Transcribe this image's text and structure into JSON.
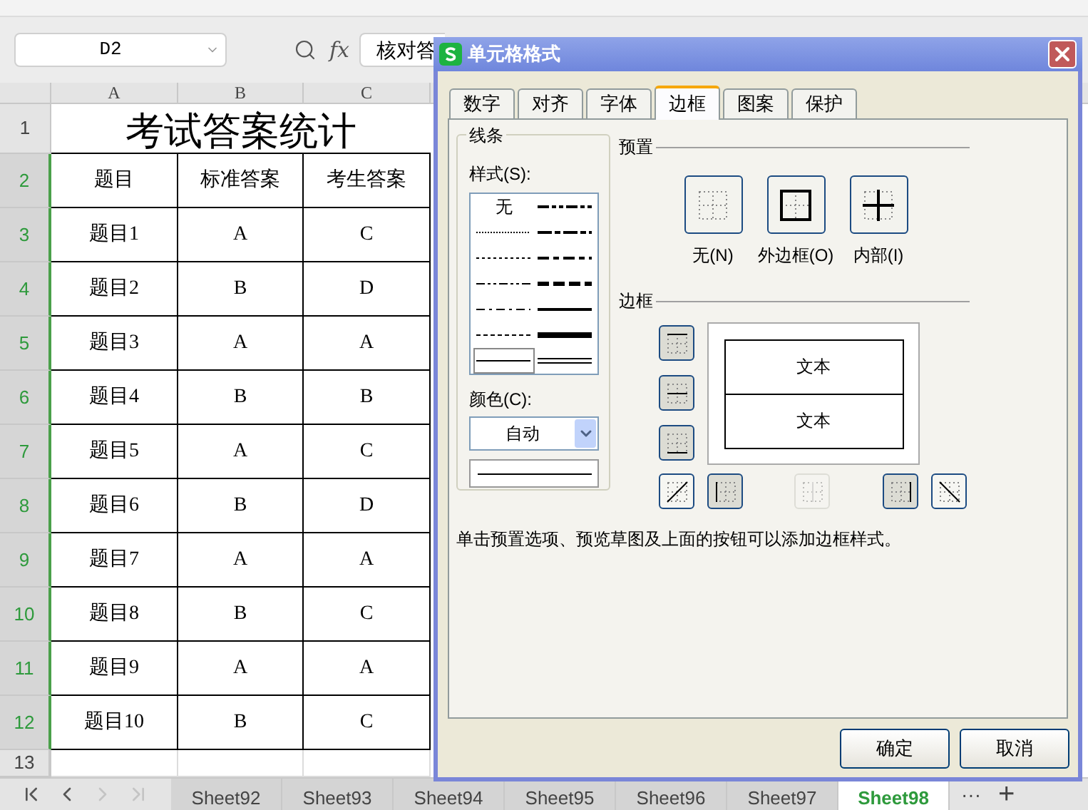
{
  "formula_bar": {
    "name_box": "D2",
    "fx_label": "fx",
    "formula": "核对答"
  },
  "sheet": {
    "columns": [
      "A",
      "B",
      "C"
    ],
    "title_row": {
      "number": "1",
      "title": "考试答案统计",
      "selected": false
    },
    "rows": [
      {
        "number": "2",
        "cells": [
          "题目",
          "标准答案",
          "考生答案"
        ],
        "selected": true
      },
      {
        "number": "3",
        "cells": [
          "题目1",
          "A",
          "C"
        ],
        "selected": true
      },
      {
        "number": "4",
        "cells": [
          "题目2",
          "B",
          "D"
        ],
        "selected": true
      },
      {
        "number": "5",
        "cells": [
          "题目3",
          "A",
          "A"
        ],
        "selected": true
      },
      {
        "number": "6",
        "cells": [
          "题目4",
          "B",
          "B"
        ],
        "selected": true
      },
      {
        "number": "7",
        "cells": [
          "题目5",
          "A",
          "C"
        ],
        "selected": true
      },
      {
        "number": "8",
        "cells": [
          "题目6",
          "B",
          "D"
        ],
        "selected": true
      },
      {
        "number": "9",
        "cells": [
          "题目7",
          "A",
          "A"
        ],
        "selected": true
      },
      {
        "number": "10",
        "cells": [
          "题目8",
          "B",
          "C"
        ],
        "selected": true
      },
      {
        "number": "11",
        "cells": [
          "题目9",
          "A",
          "A"
        ],
        "selected": true
      },
      {
        "number": "12",
        "cells": [
          "题目10",
          "B",
          "C"
        ],
        "selected": true
      },
      {
        "number": "13",
        "cells": [],
        "selected": false
      }
    ]
  },
  "sheet_tabs": [
    {
      "label": "Sheet92",
      "selected": false
    },
    {
      "label": "Sheet93",
      "selected": false
    },
    {
      "label": "Sheet94",
      "selected": false
    },
    {
      "label": "Sheet95",
      "selected": false
    },
    {
      "label": "Sheet96",
      "selected": false
    },
    {
      "label": "Sheet97",
      "selected": false
    },
    {
      "label": "Sheet98",
      "selected": true
    }
  ],
  "sheet_tab_more": "···",
  "sheet_tab_add": "+",
  "dialog": {
    "title": "单元格格式",
    "tabs": [
      {
        "label": "数字",
        "selected": false
      },
      {
        "label": "对齐",
        "selected": false
      },
      {
        "label": "字体",
        "selected": false
      },
      {
        "label": "边框",
        "selected": true
      },
      {
        "label": "图案",
        "selected": false
      },
      {
        "label": "保护",
        "selected": false
      }
    ],
    "line_group": {
      "label": "线条",
      "style_label": "样式(S):",
      "none_label": "无",
      "styles": [
        {
          "kind": "none",
          "selected": false
        },
        {
          "kind": "mdashdotdot",
          "selected": false
        },
        {
          "kind": "hair",
          "selected": false
        },
        {
          "kind": "slant",
          "selected": false
        },
        {
          "kind": "dotted",
          "selected": false
        },
        {
          "kind": "mdashdot",
          "selected": false
        },
        {
          "kind": "dashdotdot",
          "selected": false
        },
        {
          "kind": "mdashed",
          "selected": false
        },
        {
          "kind": "dashdot",
          "selected": false
        },
        {
          "kind": "medium",
          "selected": false
        },
        {
          "kind": "dashed",
          "selected": false
        },
        {
          "kind": "thick",
          "selected": false
        },
        {
          "kind": "thin",
          "selected": true
        },
        {
          "kind": "double",
          "selected": false
        }
      ],
      "color_label": "颜色(C):",
      "color_value": "自动"
    },
    "preset_label": "预置",
    "presets": [
      {
        "kind": "none",
        "label": "无(N)"
      },
      {
        "kind": "outline",
        "label": "外边框(O)"
      },
      {
        "kind": "inside",
        "label": "内部(I)"
      }
    ],
    "border_label": "边框",
    "side_buttons": [
      {
        "kind": "top",
        "pressed": true,
        "disabled": false
      },
      {
        "kind": "middle",
        "pressed": true,
        "disabled": false
      },
      {
        "kind": "bottom",
        "pressed": true,
        "disabled": false
      }
    ],
    "bottom_buttons": [
      {
        "kind": "diagup",
        "pressed": false,
        "disabled": false
      },
      {
        "kind": "left",
        "pressed": true,
        "disabled": false
      },
      {
        "kind": "vertical",
        "pressed": false,
        "disabled": true
      },
      {
        "kind": "right",
        "pressed": true,
        "disabled": false
      },
      {
        "kind": "diagdown",
        "pressed": false,
        "disabled": false
      }
    ],
    "preview_texts": [
      "文本",
      "文本"
    ],
    "hint": "单击预置选项、预览草图及上面的按钮可以添加边框样式。",
    "buttons": [
      "确定",
      "取消"
    ]
  }
}
